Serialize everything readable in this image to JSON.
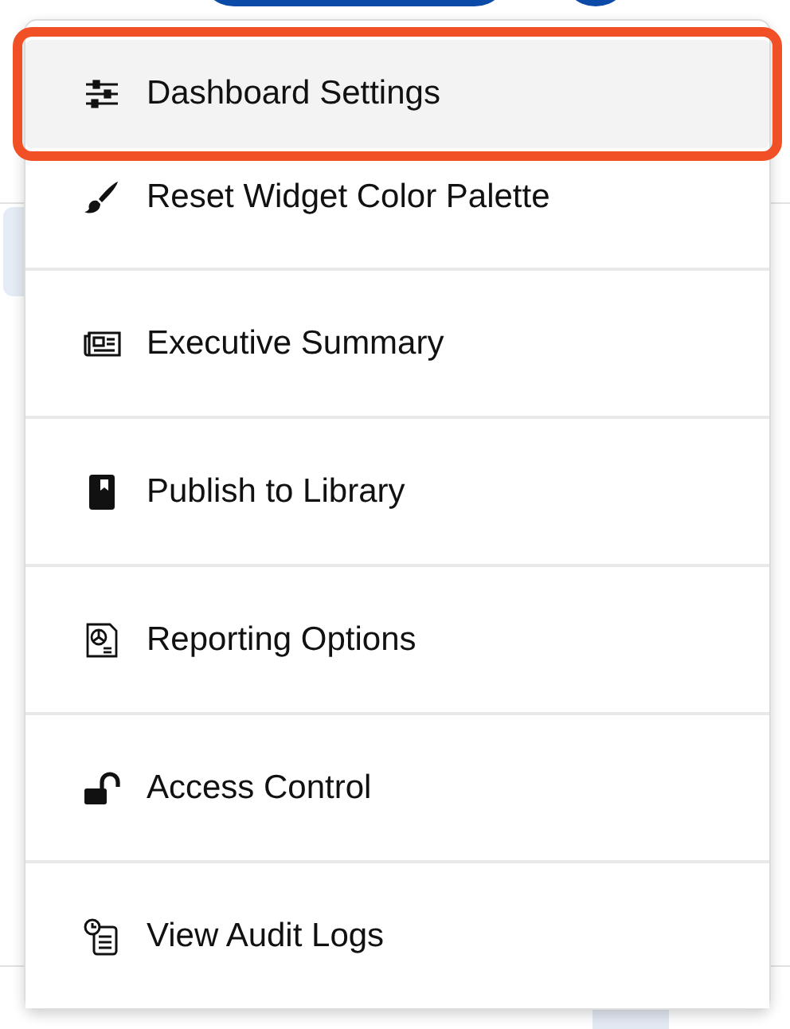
{
  "menu": {
    "items": [
      {
        "kind": "sliders",
        "label": "Dashboard Settings",
        "selected": true
      },
      {
        "kind": "brush",
        "label": "Reset Widget Color Palette",
        "selected": false
      },
      {
        "kind": "newspaper",
        "label": "Executive Summary",
        "selected": false
      },
      {
        "kind": "book",
        "label": "Publish to Library",
        "selected": false
      },
      {
        "kind": "report",
        "label": "Reporting Options",
        "selected": false
      },
      {
        "kind": "unlock",
        "label": "Access Control",
        "selected": false
      },
      {
        "kind": "log",
        "label": "View Audit Logs",
        "selected": false
      }
    ]
  }
}
